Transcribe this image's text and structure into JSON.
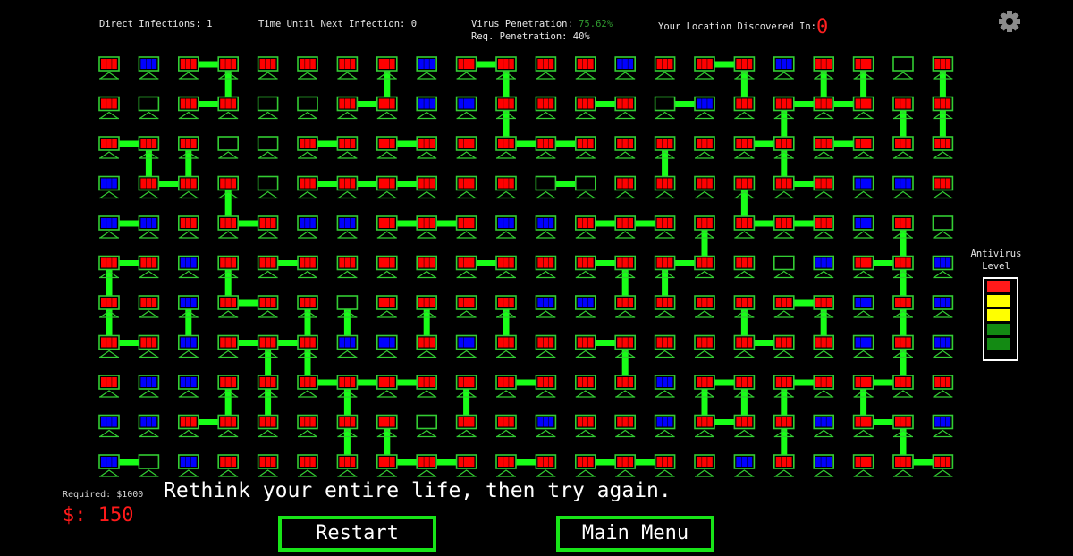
{
  "hud": {
    "direct_infections_label": "Direct Infections: ",
    "direct_infections": "1",
    "next_infection_label": "Time Until Next Infection: ",
    "next_infection": "0",
    "virus_penetration_label": "Virus Penetration: ",
    "virus_penetration": "75.62%",
    "req_penetration_label": "Req. Penetration: ",
    "req_penetration": "40%",
    "discovered_label": "Your Location Discovered In:",
    "discovered_in": "0",
    "settings_icon": "gear-icon"
  },
  "antivirus": {
    "label_line1": "Antivirus",
    "label_line2": "Level",
    "segments": [
      "#ff1a1a",
      "#ffff00",
      "#ffff00",
      "#138a13",
      "#138a13"
    ]
  },
  "colors": {
    "infected": "#ff0000",
    "protected": "#0000ff",
    "frame": "#33cc33",
    "link": "#18ff18",
    "warning": "#ff1a1a"
  },
  "network": {
    "legend": {
      "R": "infected",
      "B": "protected",
      "E": "clean"
    },
    "rows": [
      "RBRRRRRRBRRRRBRRRBRRER",
      "RERREERRBBRRRREBRRRRRR",
      "RRREERRRRRRRRRRRRRRRRR",
      "BRRRERRRRRREERRRRRRBBR",
      "BBRRRBBRRRBBRRRRRRRBRE",
      "RRBRRRRRRRRRRRRRREBRRB",
      "RRBRRRERRRRBBRRRRRRBRB",
      "RRBRRRBBRBRRRRRRRRRBRB",
      "RBBRRRRRRRRRRRBRRRRRRR",
      "BBRRRRRRERRBRRBRRRBRRB",
      "BEBRRRRRRRRRRRRRBRBRRR"
    ],
    "h_links": [
      [
        2,
        9,
        15
      ],
      [
        2,
        6,
        12,
        14,
        17,
        18
      ],
      [
        0,
        5,
        7,
        10,
        11,
        16,
        18
      ],
      [
        1,
        5,
        6,
        7,
        11,
        17
      ],
      [
        0,
        3,
        7,
        8,
        12,
        13,
        16,
        17
      ],
      [
        0,
        4,
        9,
        12,
        14,
        19
      ],
      [
        3,
        17
      ],
      [
        0,
        3,
        4,
        12,
        16
      ],
      [
        5,
        6,
        7,
        10,
        15,
        17,
        19
      ],
      [
        2,
        15,
        19
      ],
      [
        0,
        7,
        8,
        10,
        12,
        13,
        20
      ]
    ],
    "v_links": [
      [
        3,
        7,
        10,
        16,
        18,
        19,
        21
      ],
      [
        10,
        17,
        20,
        21
      ],
      [
        1,
        2,
        14,
        17
      ],
      [
        3,
        16
      ],
      [
        15,
        20
      ],
      [
        0,
        3,
        13,
        14,
        20
      ],
      [
        0,
        2,
        5,
        6,
        8,
        10,
        16,
        18,
        20
      ],
      [
        4,
        5,
        13,
        20
      ],
      [
        3,
        4,
        6,
        9,
        15,
        16,
        17,
        19
      ],
      [
        6,
        7,
        17,
        20
      ]
    ]
  },
  "footer": {
    "required_label": "Required: $1000",
    "money_label": "$: 150",
    "message": "Rethink your entire life, then try again.",
    "restart_label": "Restart",
    "main_menu_label": "Main Menu"
  }
}
